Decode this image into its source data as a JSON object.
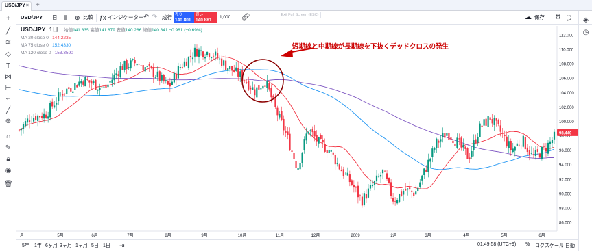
{
  "tab": {
    "title": "USD/JPY",
    "close": "×",
    "new": "+"
  },
  "toolbar": {
    "symbol_search": "USD/JPY",
    "interval": "日",
    "compare": "比較",
    "indicators": "インジケーター",
    "undo": "↶",
    "redo": "↷",
    "order_type": "成行",
    "sell_label": "売り",
    "sell_price": "140.801",
    "buy_label": "買い",
    "buy_price": "140.881",
    "quantity": "1,000",
    "link_icon": "link-icon",
    "save": "保存",
    "watermark": "Exit Full Screen (ESC)"
  },
  "legend": {
    "symbol": "USD/JPY",
    "interval": "1日",
    "open_label": "始値",
    "open": "141.835",
    "high_label": "高値",
    "high": "141.879",
    "low_label": "安値",
    "low": "140.286",
    "close_label": "終値",
    "close": "140.841",
    "change": "−0.981 (−0.69%)",
    "ma20_label": "MA 20 close 0",
    "ma20_value": "144.2235",
    "ma75_label": "MA 75 close 0",
    "ma75_value": "152.4330",
    "ma120_label": "MA 120 close 0",
    "ma120_value": "153.3590"
  },
  "annotation": "短期線と中期線が長期線を下抜くデッドクロスの発生",
  "colors": {
    "up": "#089981",
    "down": "#f23645",
    "ma20": "#f23645",
    "ma75": "#2196f3",
    "ma120": "#7e57c2",
    "annotation": "#cc0000",
    "last_price": "#f23645"
  },
  "chart_data": {
    "type": "candlestick",
    "ylim": [
      86,
      113
    ],
    "y_ticks": [
      "112.000",
      "110.000",
      "108.000",
      "106.000",
      "104.000",
      "102.000",
      "100.000",
      "98.000",
      "96.000",
      "94.000",
      "92.000",
      "90.000",
      "88.000",
      "86.000"
    ],
    "last_price_label": "98.440",
    "x_ticks": [
      "月",
      "5月",
      "6月",
      "7月",
      "8月",
      "9月",
      "10月",
      "11月",
      "12月",
      "2009",
      "2月",
      "3月",
      "4月",
      "5月",
      "6月"
    ],
    "series": [
      {
        "name": "MA 20 close 0"
      },
      {
        "name": "MA 75 close 0"
      },
      {
        "name": "MA 120 close 0"
      }
    ]
  },
  "timeframes": [
    "5年",
    "1年",
    "6ヶ月",
    "3ヶ月",
    "1ヶ月",
    "5日",
    "1日"
  ],
  "bottom": {
    "time": "01:49:58 (UTC+9)",
    "percent": "%",
    "log": "ログスケール",
    "auto": "自動"
  }
}
